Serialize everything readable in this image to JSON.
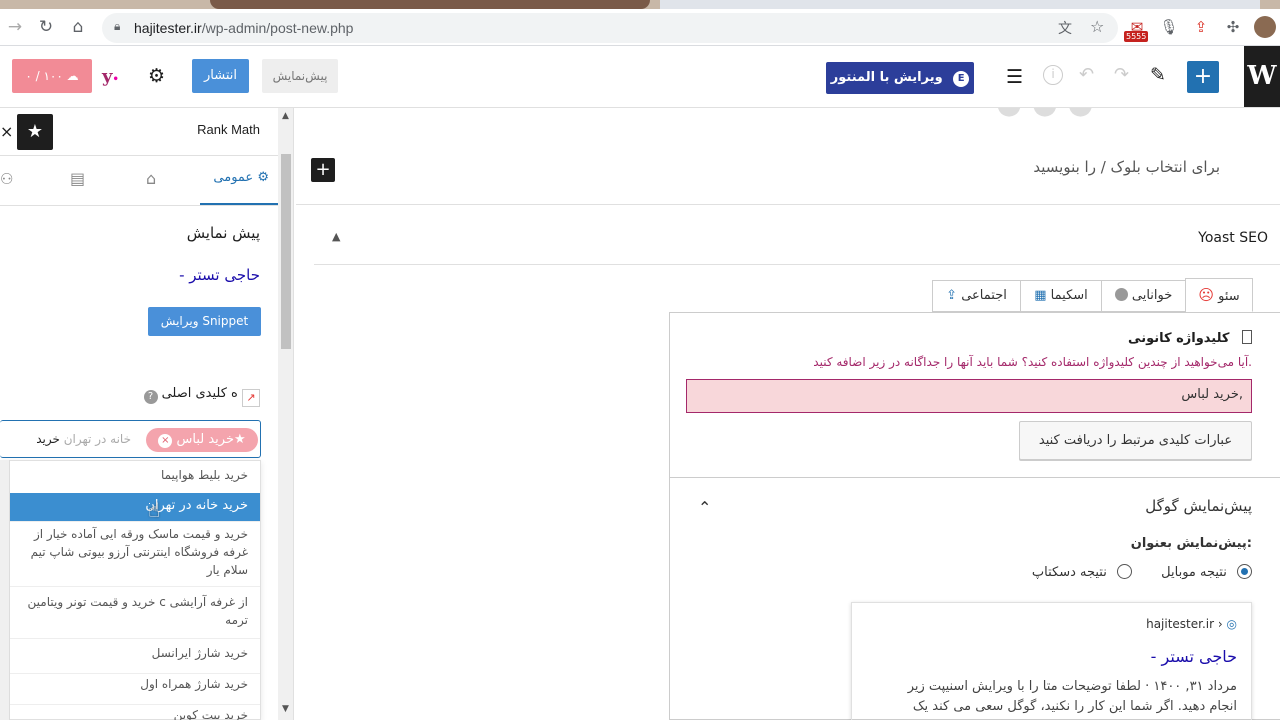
{
  "browser": {
    "url_host": "hajitester.ir",
    "url_path": "/wp-admin/post-new.php",
    "mail_badge": "5555"
  },
  "toolbar": {
    "elementor_button": "ویرایش با المنتور",
    "publish_button": "انتشار",
    "preview_button": "پیش‌نمایش",
    "score_badge": "۰ / ۱۰۰"
  },
  "editor": {
    "block_placeholder": "برای انتخاب بلوک / را بنویسید"
  },
  "yoast": {
    "title": "Yoast SEO",
    "tabs": {
      "seo": "سئو",
      "readability": "خوانایی",
      "schema": "اسکیما",
      "social": "اجتماعی"
    },
    "focus_keyword_label": "کلیدواژه کانونی",
    "warning": "آیا می‌خواهید از چندین کلیدواژه استفاده کنید؟ شما باید آنها را جداگانه در زیر اضافه کنید.",
    "keyword_value": "خرید لباس,",
    "related_button": "عبارات کلیدی مرتبط را دریافت کنید",
    "google_preview_title": "پیش‌نمایش گوگل",
    "preview_as": "پیش‌نمایش بعنوان:",
    "mobile_result": "نتیجه موبایل",
    "desktop_result": "نتیجه دسکتاپ",
    "snippet_site": "hajitester.ir ›",
    "snippet_title": "- حاجی تستر",
    "snippet_desc_line1": "مرداد ۳۱, ۱۴۰۰ · لطفا توضیحات متا را با ویرایش اسنیپت زیر",
    "snippet_desc_line2": "انجام دهید. اگر شما این کار را نکنید، گوگل سعی می کند یک"
  },
  "rankmath": {
    "title": "Rank Math",
    "tab_general": "عمومی",
    "preview_heading": "پیش نمایش",
    "preview_title": "- حاجی تستر",
    "edit_snippet_button": "ویرایش Snippet",
    "focus_keyword_label": "ه کلیدی اصلی",
    "tag_chip": "خرید لباس",
    "input_typed": "خرید",
    "input_ghost": "خانه در تهران",
    "suggestions": [
      "خرید بلیط هواپیما",
      "خرید خانه در تهران",
      "خرید و قیمت ماسک ورقه ایی آماده خیار از غرفه فروشگاه اینترنتی آرزو بیوتی شاپ تیم سلام یار",
      "خرید و قیمت تونر ویتامین c از غرفه آرایشی ترمه",
      "خرید شارژ ایرانسل",
      "خرید شارژ همراه اول",
      "خرید بیت کوین"
    ]
  },
  "colors": {
    "accent": "#2271b1",
    "publish": "#4a90d9",
    "score_bg": "#f28b96",
    "highlight": "#3b8ed0",
    "chip": "#f4a4ad"
  }
}
